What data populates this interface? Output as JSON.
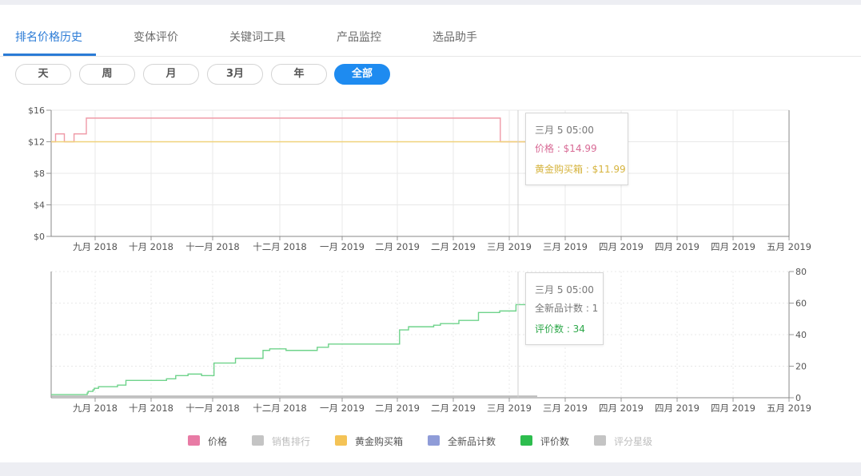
{
  "tabs": [
    {
      "label": "排名价格历史",
      "active": true
    },
    {
      "label": "变体评价",
      "active": false
    },
    {
      "label": "关键词工具",
      "active": false
    },
    {
      "label": "产品监控",
      "active": false
    },
    {
      "label": "选品助手",
      "active": false
    }
  ],
  "range_buttons": [
    {
      "label": "天",
      "active": false
    },
    {
      "label": "周",
      "active": false
    },
    {
      "label": "月",
      "active": false
    },
    {
      "label": "3月",
      "active": false
    },
    {
      "label": "年",
      "active": false
    },
    {
      "label": "全部",
      "active": true
    }
  ],
  "x_ticks": [
    "九月 2018",
    "十月 2018",
    "十一月 2018",
    "十二月 2018",
    "一月 2019",
    "二月 2019",
    "二月 2019",
    "三月 2019",
    "三月 2019",
    "四月 2019",
    "四月 2019",
    "四月 2019",
    "五月 2019"
  ],
  "tooltip_price": {
    "title": "三月 5 05:00",
    "price": "价格 : $14.99",
    "buybox": "黄金购买箱 : $11.99"
  },
  "tooltip_reviews": {
    "title": "三月 5 05:00",
    "new_count": "全新品计数 : 1",
    "reviews": "评价数 : 34"
  },
  "legend": [
    {
      "label": "价格",
      "color": "#e87ba5",
      "active": true
    },
    {
      "label": "销售排行",
      "color": "#c4c4c4",
      "active": false
    },
    {
      "label": "黄金购买箱",
      "color": "#f4c356",
      "active": true
    },
    {
      "label": "全新品计数",
      "color": "#8f9cd8",
      "active": true
    },
    {
      "label": "评价数",
      "color": "#2dbd4e",
      "active": true
    },
    {
      "label": "评分星级",
      "color": "#c4c4c4",
      "active": false
    }
  ],
  "colors": {
    "accent": "#2b7bd6",
    "price": "#ef9aa7",
    "buybox": "#f0d27a",
    "reviews": "#6fd38b",
    "new_count": "#a9a9a9",
    "tooltip_price": "#d86a95",
    "tooltip_buybox": "#d6b43f",
    "tooltip_reviews": "#2ea84a"
  },
  "chart_data": [
    {
      "type": "line",
      "step": true,
      "y_ticks": [
        "$0",
        "$4",
        "$8",
        "$12",
        "$16"
      ],
      "ylim": [
        0,
        16
      ],
      "grid": true,
      "series": [
        {
          "name": "价格",
          "points": [
            [
              0,
              12
            ],
            [
              0.1,
              13
            ],
            [
              0.3,
              12
            ],
            [
              0.52,
              13
            ],
            [
              0.8,
              15
            ],
            [
              7.6,
              15
            ],
            [
              7.84,
              12
            ],
            [
              8.5,
              12
            ]
          ]
        },
        {
          "name": "黄金购买箱",
          "points": [
            [
              0,
              12
            ],
            [
              8.5,
              12
            ]
          ]
        }
      ],
      "tooltip_at": 5.05
    },
    {
      "type": "line",
      "step": true,
      "y_ticks": [
        "0",
        "20",
        "40",
        "60",
        "80"
      ],
      "ylim": [
        0,
        80
      ],
      "grid": true,
      "series": [
        {
          "name": "评价数",
          "points": [
            [
              0,
              2
            ],
            [
              0.45,
              2
            ],
            [
              0.82,
              3
            ],
            [
              0.84,
              4
            ],
            [
              0.95,
              5
            ],
            [
              0.98,
              6
            ],
            [
              1.06,
              7
            ],
            [
              1.4,
              8
            ],
            [
              1.55,
              11
            ],
            [
              2.25,
              12
            ],
            [
              2.4,
              14
            ],
            [
              2.6,
              15
            ],
            [
              2.82,
              14
            ],
            [
              3.02,
              22
            ],
            [
              3.34,
              25
            ],
            [
              3.75,
              30
            ],
            [
              3.85,
              31
            ],
            [
              4.1,
              30
            ],
            [
              4.6,
              32
            ],
            [
              4.78,
              34
            ],
            [
              5.1,
              34
            ],
            [
              6.04,
              43
            ],
            [
              6.2,
              45
            ],
            [
              6.65,
              46
            ],
            [
              6.77,
              47
            ],
            [
              7.1,
              49
            ],
            [
              7.45,
              54
            ],
            [
              7.83,
              55
            ],
            [
              8.12,
              59
            ],
            [
              8.32,
              62
            ],
            [
              8.5,
              62
            ]
          ]
        },
        {
          "name": "全新品计数",
          "points": [
            [
              0,
              1
            ],
            [
              8.5,
              1
            ]
          ]
        }
      ],
      "tooltip_at": 5.05
    }
  ]
}
